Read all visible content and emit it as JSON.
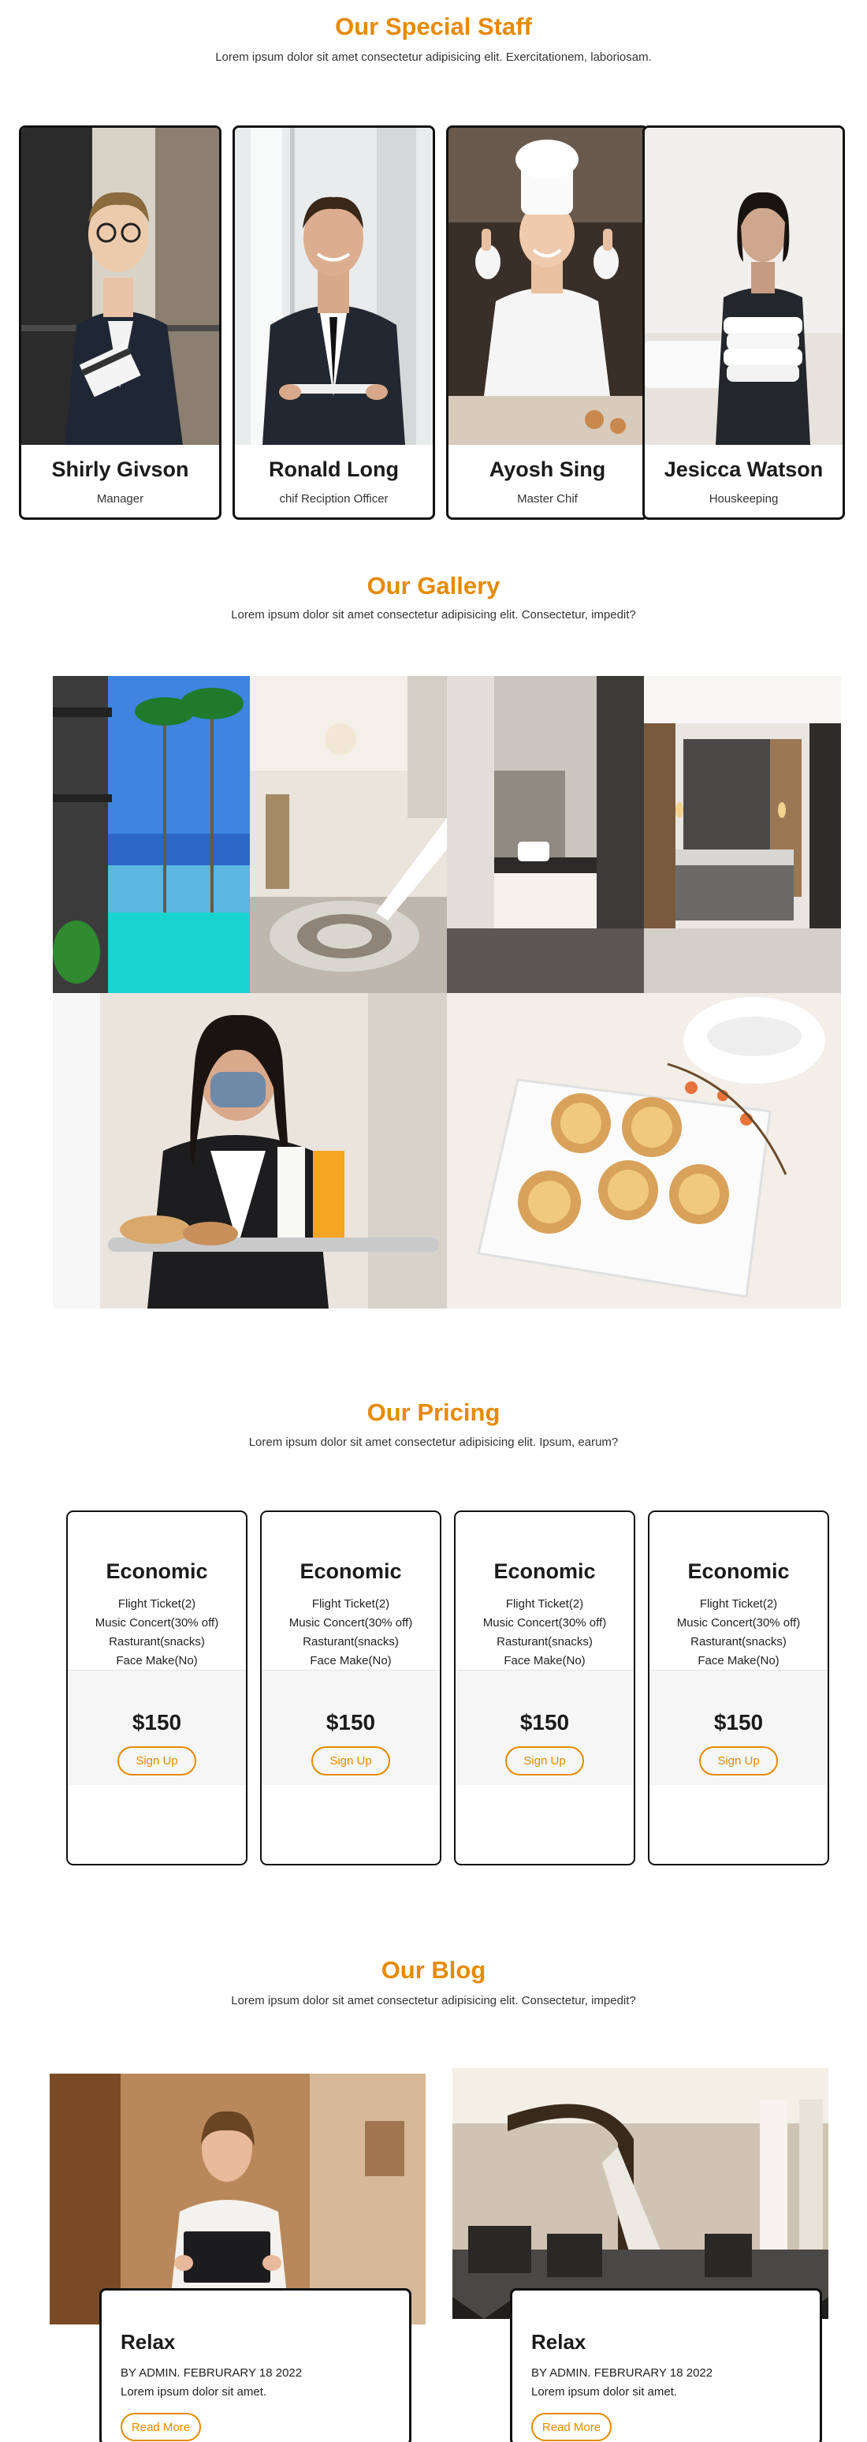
{
  "staff_section": {
    "title": "Our Special Staff",
    "subtitle": "Lorem ipsum dolor sit amet consectetur adipisicing elit. Exercitationem, laboriosam.",
    "members": [
      {
        "name": "Shirly Givson",
        "role": "Manager"
      },
      {
        "name": "Ronald Long",
        "role": "chif Reciption Officer"
      },
      {
        "name": "Ayosh Sing",
        "role": "Master Chif"
      },
      {
        "name": "Jesicca Watson",
        "role": "Houskeeping"
      }
    ]
  },
  "gallery_section": {
    "title": "Our Gallery",
    "subtitle": "Lorem ipsum dolor sit amet consectetur adipisicing elit. Consectetur, impedit?"
  },
  "pricing_section": {
    "title": "Our Pricing",
    "subtitle": "Lorem ipsum dolor sit amet consectetur adipisicing elit. Ipsum, earum?",
    "plans": [
      {
        "name": "Economic",
        "features": [
          "Flight Ticket(2)",
          "Music Concert(30% off)",
          "Rasturant(snacks)",
          "Face Make(No)"
        ],
        "price": "$150",
        "button": "Sign Up"
      },
      {
        "name": "Economic",
        "features": [
          "Flight Ticket(2)",
          "Music Concert(30% off)",
          "Rasturant(snacks)",
          "Face Make(No)"
        ],
        "price": "$150",
        "button": "Sign Up"
      },
      {
        "name": "Economic",
        "features": [
          "Flight Ticket(2)",
          "Music Concert(30% off)",
          "Rasturant(snacks)",
          "Face Make(No)"
        ],
        "price": "$150",
        "button": "Sign Up"
      },
      {
        "name": "Economic",
        "features": [
          "Flight Ticket(2)",
          "Music Concert(30% off)",
          "Rasturant(snacks)",
          "Face Make(No)"
        ],
        "price": "$150",
        "button": "Sign Up"
      }
    ]
  },
  "blog_section": {
    "title": "Our Blog",
    "subtitle": "Lorem ipsum dolor sit amet consectetur adipisicing elit. Consectetur, impedit?",
    "posts": [
      {
        "title": "Relax",
        "meta": "BY ADMIN. FEBRURARY 18 2022",
        "text": "Lorem ipsum dolor sit amet.",
        "button": "Read More"
      },
      {
        "title": "Relax",
        "meta": "BY ADMIN. FEBRURARY 18 2022",
        "text": "Lorem ipsum dolor sit amet.",
        "button": "Read More"
      }
    ]
  },
  "colors": {
    "accent": "#e68a00",
    "border": "#111111",
    "price_band": "#f6f6f6"
  }
}
